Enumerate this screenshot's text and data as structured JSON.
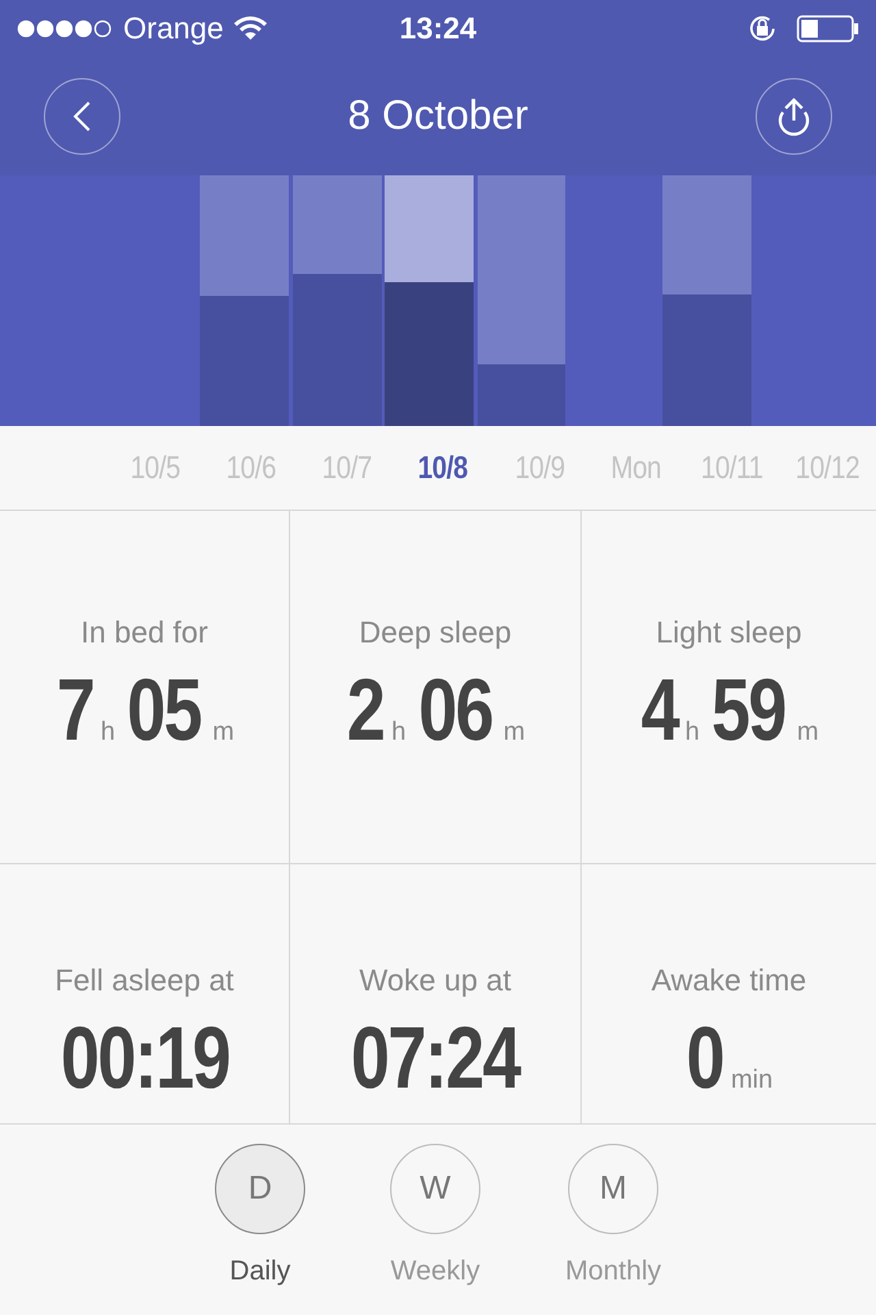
{
  "status_bar": {
    "carrier": "Orange",
    "time": "13:24"
  },
  "header": {
    "title": "8 October"
  },
  "days": [
    {
      "label": "10/5",
      "selected": false
    },
    {
      "label": "10/6",
      "selected": false
    },
    {
      "label": "10/7",
      "selected": false
    },
    {
      "label": "10/8",
      "selected": true
    },
    {
      "label": "10/9",
      "selected": false
    },
    {
      "label": "Mon",
      "selected": false
    },
    {
      "label": "10/11",
      "selected": false
    },
    {
      "label": "10/12",
      "selected": false
    }
  ],
  "stats": [
    {
      "label": "In bed for",
      "parts": [
        {
          "number": "7",
          "unit": "h"
        },
        {
          "number": "05",
          "unit": "m"
        }
      ]
    },
    {
      "label": "Deep sleep",
      "parts": [
        {
          "number": "2",
          "unit": "h"
        },
        {
          "number": "06",
          "unit": "m"
        }
      ]
    },
    {
      "label": "Light sleep",
      "parts": [
        {
          "number": "4",
          "unit": "h"
        },
        {
          "number": "59",
          "unit": "m"
        }
      ]
    },
    {
      "label": "Fell asleep at",
      "parts": [
        {
          "number": "00:19"
        }
      ]
    },
    {
      "label": "Woke up at",
      "parts": [
        {
          "number": "07:24"
        }
      ]
    },
    {
      "label": "Awake time",
      "parts": [
        {
          "number": "0",
          "unit": "min"
        }
      ]
    }
  ],
  "periods": [
    {
      "letter": "D",
      "label": "Daily",
      "selected": true
    },
    {
      "letter": "W",
      "label": "Weekly",
      "selected": false
    },
    {
      "letter": "M",
      "label": "Monthly",
      "selected": false
    }
  ]
}
